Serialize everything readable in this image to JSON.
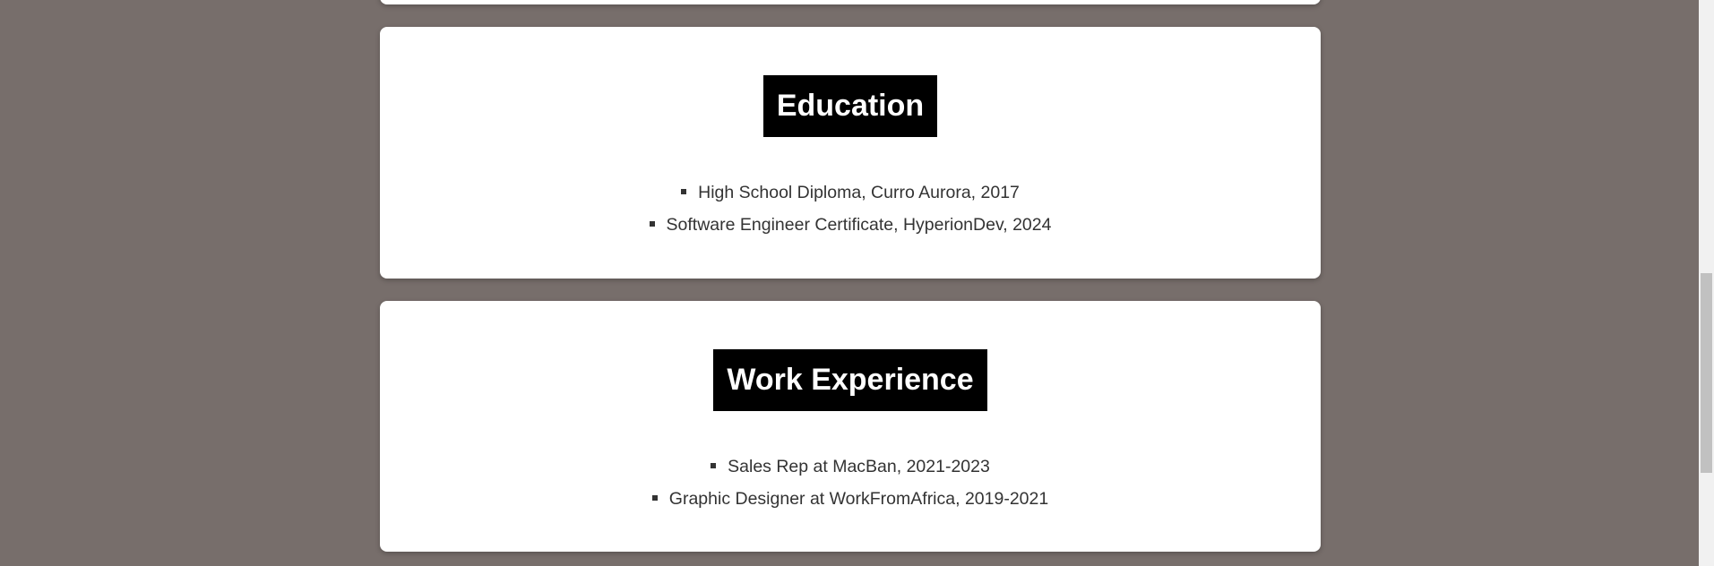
{
  "education": {
    "title": "Education",
    "items": [
      "High School Diploma, Curro Aurora, 2017",
      "Software Engineer Certificate, HyperionDev, 2024"
    ]
  },
  "work": {
    "title": "Work Experience",
    "items": [
      "Sales Rep at MacBan, 2021-2023",
      "Graphic Designer at WorkFromAfrica, 2019-2021"
    ]
  },
  "colors": {
    "page_background": "#776e6b",
    "card_background": "#ffffff",
    "title_background": "#000000",
    "title_text": "#ffffff",
    "body_text": "#333333"
  }
}
